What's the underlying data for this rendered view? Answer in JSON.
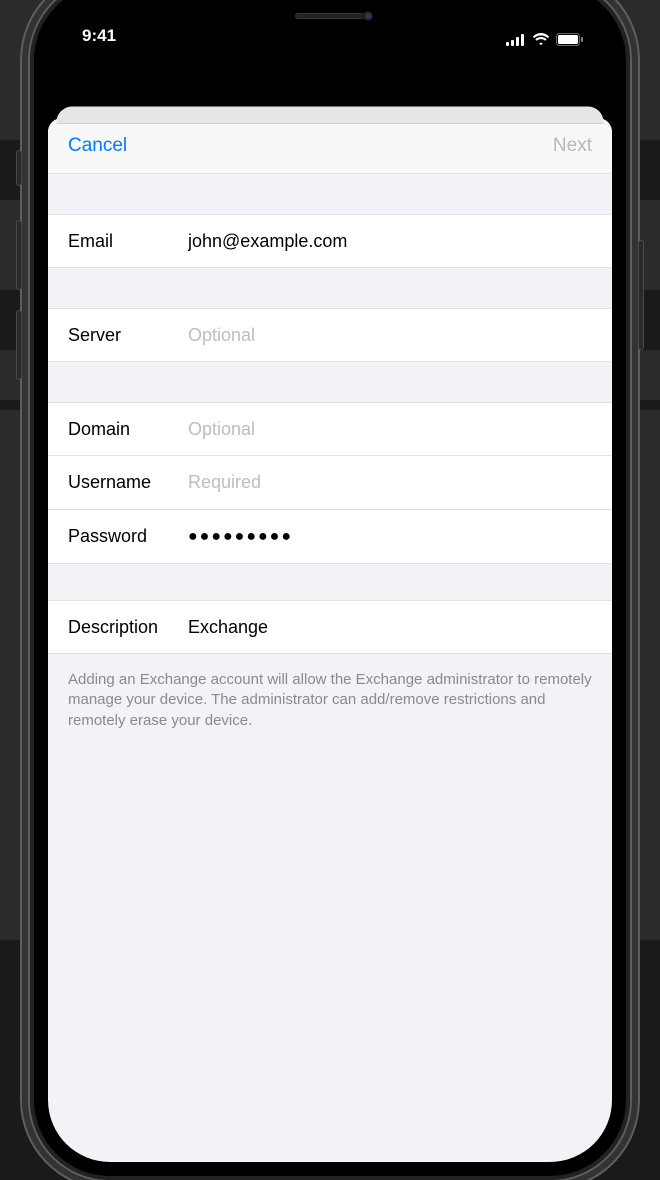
{
  "status_bar": {
    "time": "9:41"
  },
  "navbar": {
    "cancel_label": "Cancel",
    "next_label": "Next"
  },
  "fields": {
    "email": {
      "label": "Email",
      "value": "john@example.com"
    },
    "server": {
      "label": "Server",
      "placeholder": "Optional",
      "value": ""
    },
    "domain": {
      "label": "Domain",
      "placeholder": "Optional",
      "value": ""
    },
    "username": {
      "label": "Username",
      "placeholder": "Required",
      "value": ""
    },
    "password": {
      "label": "Password",
      "value": "●●●●●●●●●"
    },
    "description": {
      "label": "Description",
      "value": "Exchange"
    }
  },
  "footer": "Adding an Exchange account will allow the Exchange administrator to remotely manage your device. The administrator can add/remove restrictions and remotely erase your device."
}
